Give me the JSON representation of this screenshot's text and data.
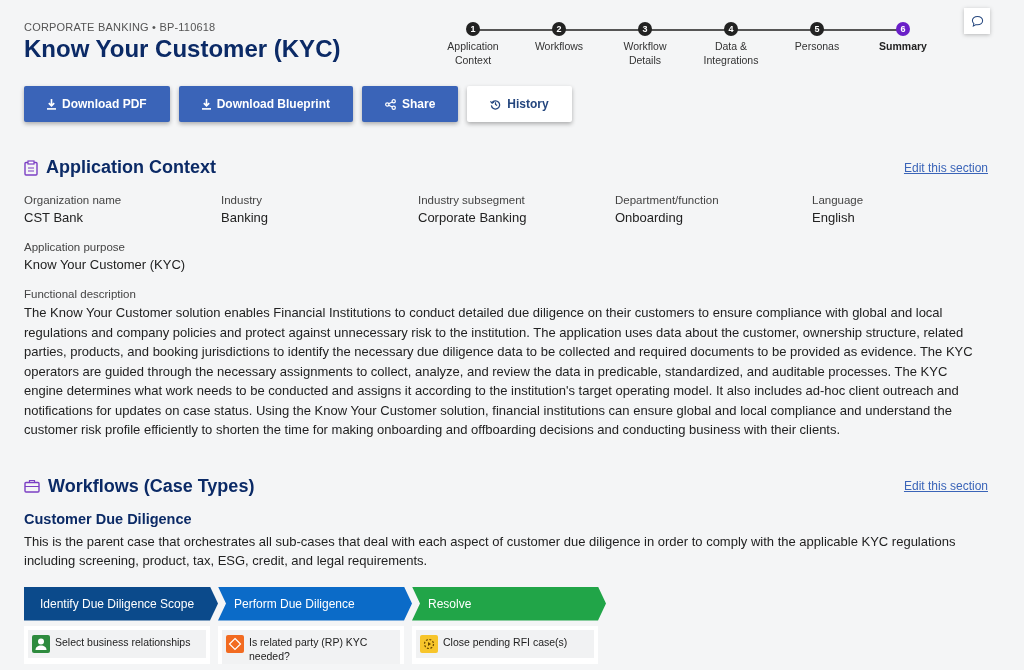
{
  "breadcrumb": "CORPORATE BANKING • BP-110618",
  "title": "Know Your Customer (KYC)",
  "steps": [
    {
      "number": "1",
      "label": "Application Context",
      "selected": false
    },
    {
      "number": "2",
      "label": "Workflows",
      "selected": false
    },
    {
      "number": "3",
      "label": "Workflow Details",
      "selected": false
    },
    {
      "number": "4",
      "label": "Data & Integrations",
      "selected": false
    },
    {
      "number": "5",
      "label": "Personas",
      "selected": false
    },
    {
      "number": "6",
      "label": "Summary",
      "selected": true
    }
  ],
  "actions": [
    {
      "label": "Download PDF",
      "kind": "download",
      "primary": true
    },
    {
      "label": "Download Blueprint",
      "kind": "download",
      "primary": true
    },
    {
      "label": "Share",
      "kind": "share",
      "primary": true
    },
    {
      "label": "History",
      "kind": "history",
      "primary": false
    }
  ],
  "application_context": {
    "heading": "Application Context",
    "edit_link": "Edit this section",
    "fields": [
      {
        "label": "Organization name",
        "value": "CST Bank"
      },
      {
        "label": "Industry",
        "value": "Banking"
      },
      {
        "label": "Industry subsegment",
        "value": "Corporate Banking"
      },
      {
        "label": "Department/function",
        "value": "Onboarding"
      },
      {
        "label": "Language",
        "value": "English"
      }
    ],
    "purpose": {
      "label": "Application purpose",
      "value": "Know Your Customer (KYC)"
    },
    "description": {
      "label": "Functional description",
      "value": "The Know Your Customer solution enables Financial Institutions to conduct detailed due diligence on their customers to ensure compliance with global and local regulations and company policies and protect against unnecessary risk to the institution. The application uses data about the customer, ownership structure, related parties, products, and booking jurisdictions to identify the necessary due diligence data to be collected and required documents to be provided as evidence. The KYC operators are guided through the necessary assignments to collect, analyze, and review the data in predicable, standardized, and auditable processes. The KYC engine determines what work needs to be conducted and assigns it according to the institution's target operating model. It also includes ad-hoc client outreach and notifications for updates on case status. Using the Know Your Customer solution, financial institutions can ensure global and local compliance and understand the customer risk profile efficiently to shorten the time for making onboarding and offboarding decisions and conducting business with their clients."
    }
  },
  "workflows": {
    "heading": "Workflows (Case Types)",
    "edit_link": "Edit this section",
    "case": {
      "name": "Customer Due Diligence",
      "description": "This is the parent case that orchestrates all sub-cases that deal with each aspect of customer due diligence in order to comply with the applicable KYC regulations including screening, product, tax, ESG, credit, and legal requirements.",
      "stages": [
        {
          "name": "Identify Due Diligence Scope",
          "color": "#0b4a8b",
          "steps": [
            {
              "label": "Select business relationships",
              "kind": "user"
            }
          ]
        },
        {
          "name": "Perform Due Diligence",
          "color": "#0b6bc8",
          "steps": [
            {
              "label": "Is related party (RP) KYC needed?",
              "kind": "decision"
            }
          ]
        },
        {
          "name": "Resolve",
          "color": "#21a548",
          "steps": [
            {
              "label": "Close pending RFI case(s)",
              "kind": "automation"
            }
          ]
        }
      ]
    }
  }
}
